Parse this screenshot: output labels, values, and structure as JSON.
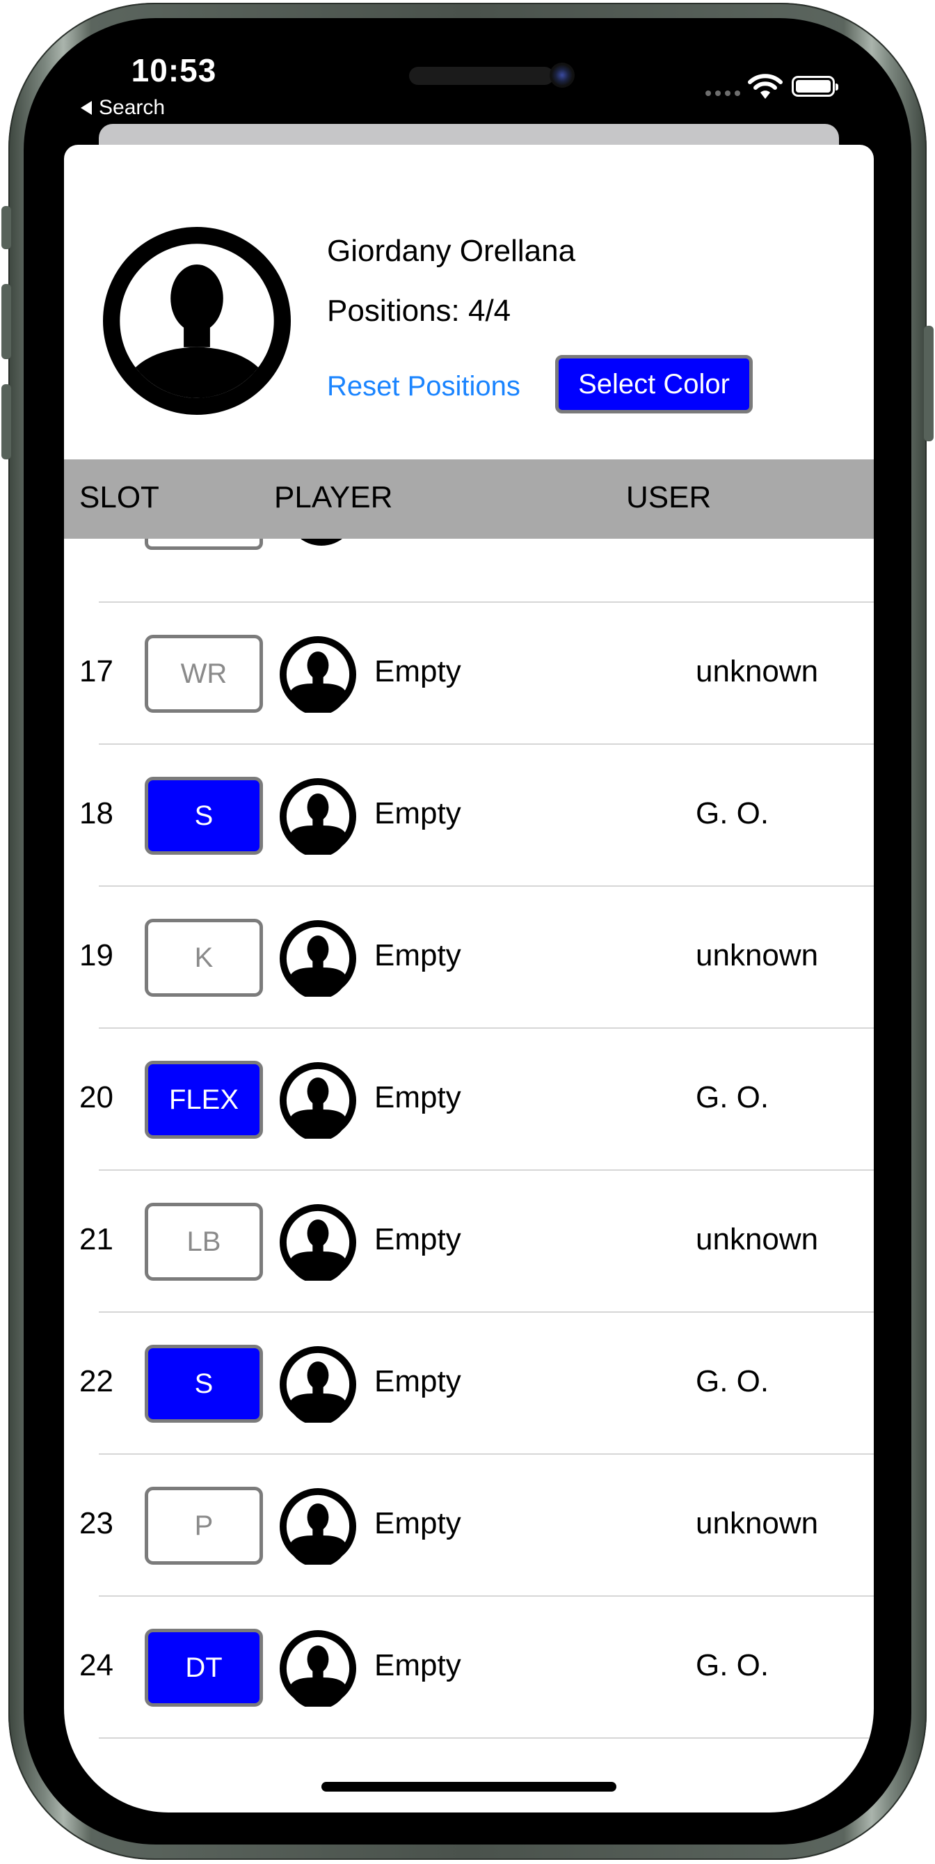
{
  "status_bar": {
    "time": "10:53",
    "back_label": "Search"
  },
  "profile": {
    "name": "Giordany Orellana",
    "positions": "Positions: 4/4",
    "reset_label": "Reset Positions",
    "select_color_label": "Select Color"
  },
  "table": {
    "headers": {
      "slot": "SLOT",
      "player": "PLAYER",
      "user": "USER"
    },
    "rows": [
      {
        "slot": "17",
        "position": "WR",
        "player": "Empty",
        "user": "unknown",
        "taken": false
      },
      {
        "slot": "18",
        "position": "S",
        "player": "Empty",
        "user": "G. O.",
        "taken": true
      },
      {
        "slot": "19",
        "position": "K",
        "player": "Empty",
        "user": "unknown",
        "taken": false
      },
      {
        "slot": "20",
        "position": "FLEX",
        "player": "Empty",
        "user": "G. O.",
        "taken": true
      },
      {
        "slot": "21",
        "position": "LB",
        "player": "Empty",
        "user": "unknown",
        "taken": false
      },
      {
        "slot": "22",
        "position": "S",
        "player": "Empty",
        "user": "G. O.",
        "taken": true
      },
      {
        "slot": "23",
        "position": "P",
        "player": "Empty",
        "user": "unknown",
        "taken": false
      },
      {
        "slot": "24",
        "position": "DT",
        "player": "Empty",
        "user": "G. O.",
        "taken": true
      }
    ]
  },
  "colors": {
    "accent_blue": "#0000ff",
    "link_blue": "#1a84ff",
    "header_gray": "#a9a9a9"
  },
  "icons": {
    "avatar": "person-silhouette-icon",
    "back": "back-arrow-icon",
    "wifi": "wifi-icon",
    "battery": "battery-icon"
  }
}
